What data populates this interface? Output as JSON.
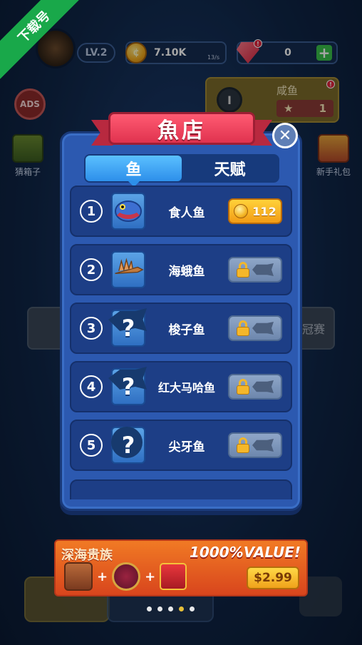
{
  "watermark": {
    "text": "下载号"
  },
  "hud": {
    "level": "LV.2",
    "coins": "7.10K",
    "coin_rate": "13/s",
    "gems": "0",
    "salted_fish": {
      "title": "咸鱼",
      "badge": "I",
      "count": "1"
    },
    "ads_label": "ADS",
    "left_gift_label": "猜箱子",
    "right_gift_label": "新手礼包",
    "right_panel_label": "冠赛"
  },
  "dialog": {
    "title": "魚店",
    "tabs": [
      {
        "label": "鱼",
        "active": true
      },
      {
        "label": "天赋",
        "active": false
      }
    ],
    "fish": [
      {
        "index": "1",
        "name": "食人鱼",
        "price": "112",
        "locked": false
      },
      {
        "index": "2",
        "name": "海蛾鱼",
        "locked": true
      },
      {
        "index": "3",
        "name": "梭子鱼",
        "locked": true
      },
      {
        "index": "4",
        "name": "红大马哈鱼",
        "locked": true
      },
      {
        "index": "5",
        "name": "尖牙鱼",
        "locked": true
      }
    ]
  },
  "promo": {
    "title": "深海贵族",
    "value_text": "1000%VALUE!",
    "price": "$2.99"
  },
  "pager": {
    "count": 5,
    "active": 3
  },
  "colors": {
    "accent": "#2c59b0",
    "ribbon": "#e0334f",
    "gold": "#f29c16"
  }
}
